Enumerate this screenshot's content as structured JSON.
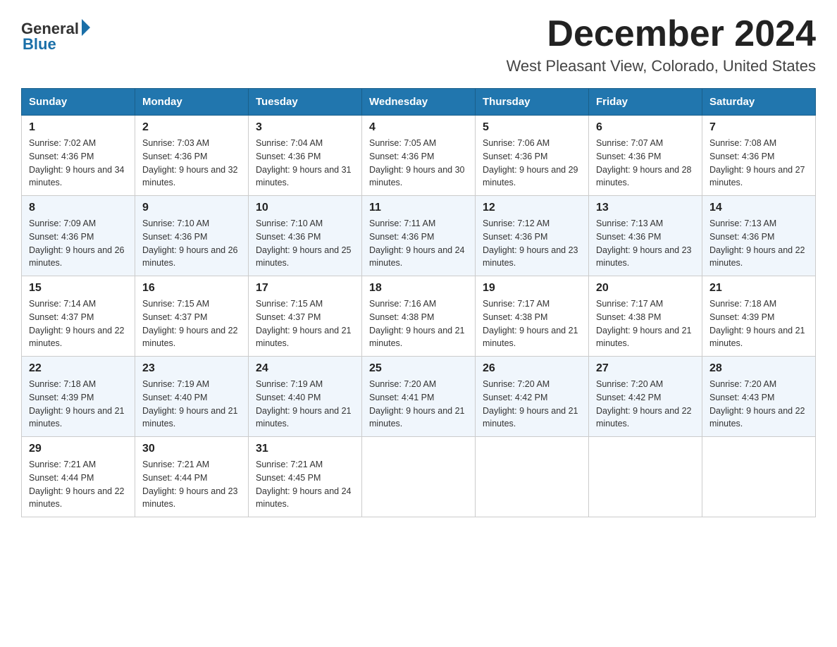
{
  "header": {
    "logo_general": "General",
    "logo_blue": "Blue",
    "month_title": "December 2024",
    "location": "West Pleasant View, Colorado, United States"
  },
  "days_of_week": [
    "Sunday",
    "Monday",
    "Tuesday",
    "Wednesday",
    "Thursday",
    "Friday",
    "Saturday"
  ],
  "weeks": [
    [
      {
        "day": "1",
        "sunrise": "7:02 AM",
        "sunset": "4:36 PM",
        "daylight": "9 hours and 34 minutes."
      },
      {
        "day": "2",
        "sunrise": "7:03 AM",
        "sunset": "4:36 PM",
        "daylight": "9 hours and 32 minutes."
      },
      {
        "day": "3",
        "sunrise": "7:04 AM",
        "sunset": "4:36 PM",
        "daylight": "9 hours and 31 minutes."
      },
      {
        "day": "4",
        "sunrise": "7:05 AM",
        "sunset": "4:36 PM",
        "daylight": "9 hours and 30 minutes."
      },
      {
        "day": "5",
        "sunrise": "7:06 AM",
        "sunset": "4:36 PM",
        "daylight": "9 hours and 29 minutes."
      },
      {
        "day": "6",
        "sunrise": "7:07 AM",
        "sunset": "4:36 PM",
        "daylight": "9 hours and 28 minutes."
      },
      {
        "day": "7",
        "sunrise": "7:08 AM",
        "sunset": "4:36 PM",
        "daylight": "9 hours and 27 minutes."
      }
    ],
    [
      {
        "day": "8",
        "sunrise": "7:09 AM",
        "sunset": "4:36 PM",
        "daylight": "9 hours and 26 minutes."
      },
      {
        "day": "9",
        "sunrise": "7:10 AM",
        "sunset": "4:36 PM",
        "daylight": "9 hours and 26 minutes."
      },
      {
        "day": "10",
        "sunrise": "7:10 AM",
        "sunset": "4:36 PM",
        "daylight": "9 hours and 25 minutes."
      },
      {
        "day": "11",
        "sunrise": "7:11 AM",
        "sunset": "4:36 PM",
        "daylight": "9 hours and 24 minutes."
      },
      {
        "day": "12",
        "sunrise": "7:12 AM",
        "sunset": "4:36 PM",
        "daylight": "9 hours and 23 minutes."
      },
      {
        "day": "13",
        "sunrise": "7:13 AM",
        "sunset": "4:36 PM",
        "daylight": "9 hours and 23 minutes."
      },
      {
        "day": "14",
        "sunrise": "7:13 AM",
        "sunset": "4:36 PM",
        "daylight": "9 hours and 22 minutes."
      }
    ],
    [
      {
        "day": "15",
        "sunrise": "7:14 AM",
        "sunset": "4:37 PM",
        "daylight": "9 hours and 22 minutes."
      },
      {
        "day": "16",
        "sunrise": "7:15 AM",
        "sunset": "4:37 PM",
        "daylight": "9 hours and 22 minutes."
      },
      {
        "day": "17",
        "sunrise": "7:15 AM",
        "sunset": "4:37 PM",
        "daylight": "9 hours and 21 minutes."
      },
      {
        "day": "18",
        "sunrise": "7:16 AM",
        "sunset": "4:38 PM",
        "daylight": "9 hours and 21 minutes."
      },
      {
        "day": "19",
        "sunrise": "7:17 AM",
        "sunset": "4:38 PM",
        "daylight": "9 hours and 21 minutes."
      },
      {
        "day": "20",
        "sunrise": "7:17 AM",
        "sunset": "4:38 PM",
        "daylight": "9 hours and 21 minutes."
      },
      {
        "day": "21",
        "sunrise": "7:18 AM",
        "sunset": "4:39 PM",
        "daylight": "9 hours and 21 minutes."
      }
    ],
    [
      {
        "day": "22",
        "sunrise": "7:18 AM",
        "sunset": "4:39 PM",
        "daylight": "9 hours and 21 minutes."
      },
      {
        "day": "23",
        "sunrise": "7:19 AM",
        "sunset": "4:40 PM",
        "daylight": "9 hours and 21 minutes."
      },
      {
        "day": "24",
        "sunrise": "7:19 AM",
        "sunset": "4:40 PM",
        "daylight": "9 hours and 21 minutes."
      },
      {
        "day": "25",
        "sunrise": "7:20 AM",
        "sunset": "4:41 PM",
        "daylight": "9 hours and 21 minutes."
      },
      {
        "day": "26",
        "sunrise": "7:20 AM",
        "sunset": "4:42 PM",
        "daylight": "9 hours and 21 minutes."
      },
      {
        "day": "27",
        "sunrise": "7:20 AM",
        "sunset": "4:42 PM",
        "daylight": "9 hours and 22 minutes."
      },
      {
        "day": "28",
        "sunrise": "7:20 AM",
        "sunset": "4:43 PM",
        "daylight": "9 hours and 22 minutes."
      }
    ],
    [
      {
        "day": "29",
        "sunrise": "7:21 AM",
        "sunset": "4:44 PM",
        "daylight": "9 hours and 22 minutes."
      },
      {
        "day": "30",
        "sunrise": "7:21 AM",
        "sunset": "4:44 PM",
        "daylight": "9 hours and 23 minutes."
      },
      {
        "day": "31",
        "sunrise": "7:21 AM",
        "sunset": "4:45 PM",
        "daylight": "9 hours and 24 minutes."
      },
      null,
      null,
      null,
      null
    ]
  ],
  "labels": {
    "sunrise_prefix": "Sunrise: ",
    "sunset_prefix": "Sunset: ",
    "daylight_prefix": "Daylight: "
  }
}
